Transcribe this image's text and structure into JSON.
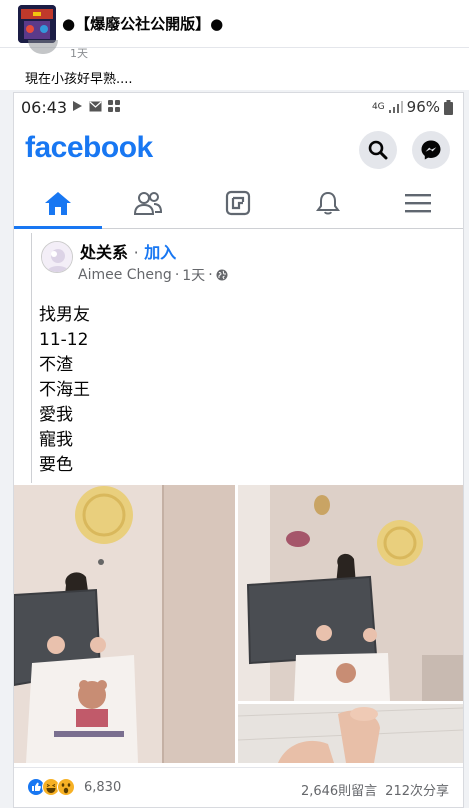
{
  "group": {
    "title": "●【爆廢公社公開版】●"
  },
  "outer_post": {
    "author_meta": "1天",
    "caption": "現在小孩好早熟...."
  },
  "status_bar": {
    "time": "06:43",
    "network": "4G",
    "battery": "96%"
  },
  "fb_header": {
    "logo": "facebook"
  },
  "tabs": [
    {
      "name": "home",
      "active": true
    },
    {
      "name": "friends",
      "active": false
    },
    {
      "name": "groups",
      "active": false
    },
    {
      "name": "notifications",
      "active": false
    },
    {
      "name": "menu",
      "active": false
    }
  ],
  "post": {
    "name": "处关系",
    "separator": "·",
    "join": "加入",
    "author": "Aimee Cheng",
    "time": "1天",
    "lines": [
      "找男友",
      "11-12",
      "不渣",
      "不海王",
      "愛我",
      "寵我",
      "要色"
    ]
  },
  "reactions": {
    "count": "6,830",
    "comments": "2,646則留言",
    "shares": "212次分享"
  },
  "colors": {
    "brand": "#1877f2",
    "like": "#1877f2",
    "haha": "#f7b125"
  }
}
